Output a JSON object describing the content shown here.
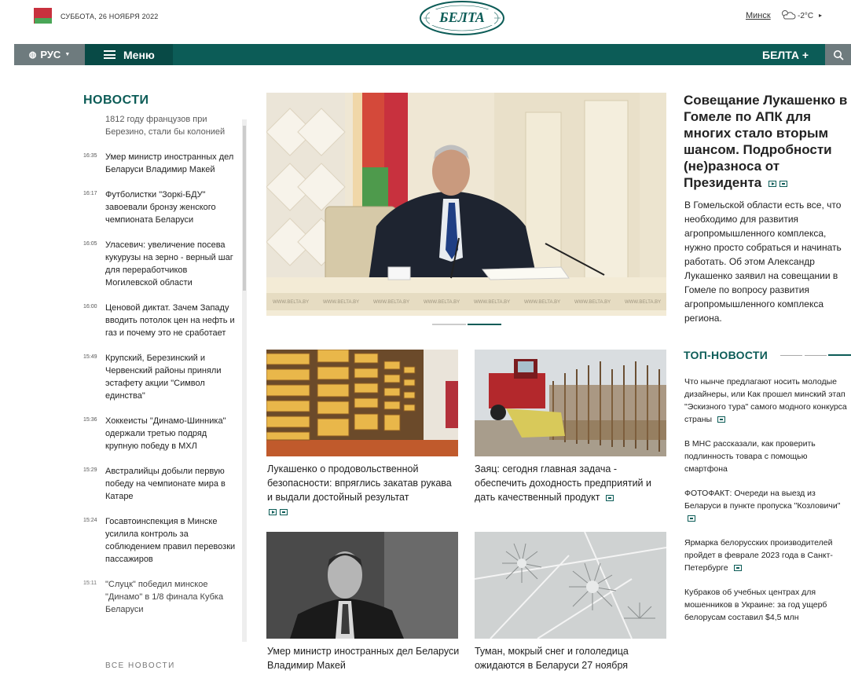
{
  "header": {
    "date": "СУББОТА, 26 НОЯБРЯ 2022",
    "logo_text": "БЕЛТА",
    "city": "Минск",
    "temperature": "-2°C",
    "weather_icon": "cloudy-icon"
  },
  "nav": {
    "lang": "РУС",
    "menu": "Меню",
    "belta_plus": "БЕЛТА +"
  },
  "news": {
    "heading": "НОВОСТИ",
    "items": [
      {
        "time": "",
        "text": "1812 году французов при Березино, стали бы колонией"
      },
      {
        "time": "16:35",
        "text": "Умер министр иностранных дел Беларуси Владимир Макей"
      },
      {
        "time": "16:17",
        "text": "Футболистки \"Зоркі-БДУ\" завоевали бронзу женского чемпионата Беларуси"
      },
      {
        "time": "16:05",
        "text": "Уласевич: увеличение посева кукурузы на зерно - верный шаг для переработчиков Могилевской области"
      },
      {
        "time": "16:00",
        "text": "Ценовой диктат. Зачем Западу вводить потолок цен на нефть и газ и почему это не сработает"
      },
      {
        "time": "15:49",
        "text": "Крупский, Березинский и Червенский районы приняли эстафету акции \"Символ единства\""
      },
      {
        "time": "15:36",
        "text": "Хоккеисты \"Динамо-Шинника\" одержали третью подряд крупную победу в МХЛ"
      },
      {
        "time": "15:29",
        "text": "Австралийцы добыли первую победу на чемпионате мира в Катаре"
      },
      {
        "time": "15:24",
        "text": "Госавтоинспекция в Минске усилила контроль за соблюдением правил перевозки пассажиров"
      },
      {
        "time": "15:11",
        "text": "\"Слуцк\" победил минское \"Динамо\" в 1/8 финала Кубка Беларуси"
      }
    ],
    "all_news": "ВСЕ НОВОСТИ"
  },
  "hero": {
    "title": "Совещание Лукашенко в Гомеле по АПК для многих стало вторым шансом. Подробности (не)разноса от Президента",
    "text": "В Гомельской области есть все, что необходимо для развития агропромышленного комплекса, нужно просто собраться и начинать работать. Об этом Александр Лукашенко заявил на совещании в Гомеле по вопросу развития агропромышленного комплекса региона.",
    "watermark": "WWW.BELTA.BY"
  },
  "cards": [
    {
      "title": "Лукашенко о продовольственной безопасности: впряглись закатав рукава и выдали достойный результат"
    },
    {
      "title": "Заяц: сегодня главная задача - обеспечить доходность предприятий и дать качественный продукт"
    },
    {
      "title": "Умер министр иностранных дел Беларуси Владимир Макей"
    },
    {
      "title": "Туман, мокрый снег и гололедица ожидаются в Беларуси 27 ноября"
    }
  ],
  "top_news": {
    "heading": "ТОП-НОВОСТИ",
    "items": [
      {
        "text": "Что нынче предлагают носить молодые дизайнеры, или Как прошел минский этап \"Эскизного тура\" самого модного конкурса страны"
      },
      {
        "text": "В МНС рассказали, как проверить подлинность товара с помощью смартфона"
      },
      {
        "text": "ФОТОФАКТ: Очереди на выезд из Беларуси в пункте пропуска \"Козловичи\""
      },
      {
        "text": "Ярмарка белорусских производителей пройдет в феврале 2023 года в Санкт-Петербурге"
      },
      {
        "text": "Кубраков об учебных центрах для мошенников в Украине: за год ущерб белорусам составил $4,5 млн"
      }
    ]
  },
  "colors": {
    "brand": "#0c5c57",
    "nav_gray": "#6e7b7e"
  }
}
